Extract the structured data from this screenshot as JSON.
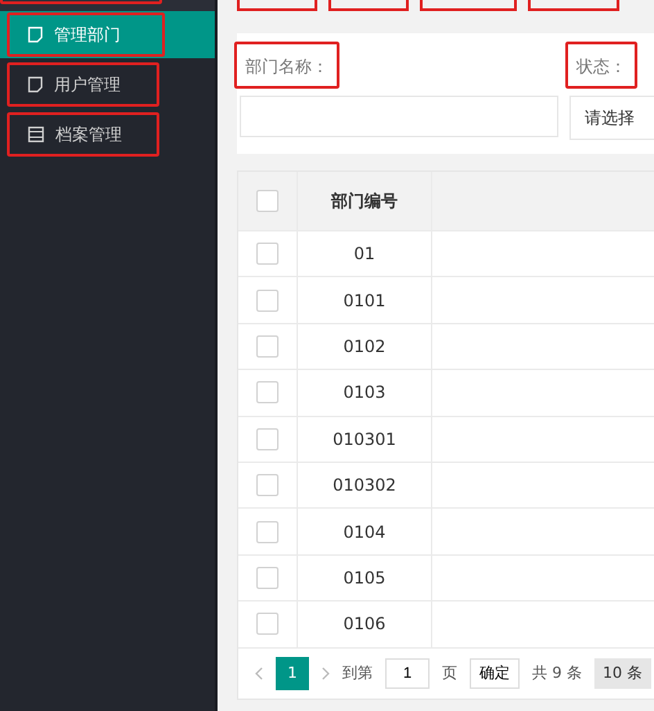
{
  "top_annotations": [
    {
      "kind": "box"
    },
    {
      "kind": "box"
    },
    {
      "kind": "box"
    },
    {
      "kind": "box"
    },
    {
      "kind": "box"
    }
  ],
  "sidebar": {
    "items": [
      {
        "label": "管理部门",
        "kind": "page",
        "selected": true,
        "highlighted": true
      },
      {
        "label": "用户管理",
        "kind": "page",
        "selected": false,
        "highlighted": true
      },
      {
        "label": "档案管理",
        "kind": "archive",
        "selected": false,
        "highlighted": true
      }
    ]
  },
  "search": {
    "fields": [
      {
        "label": "部门名称：",
        "kind": "text",
        "highlighted": true
      },
      {
        "label": "状态：",
        "kind": "select",
        "value": "请选择",
        "highlighted": true
      }
    ]
  },
  "table": {
    "select_all_checked": false,
    "columns": [
      "部门编号"
    ],
    "rows": [
      {
        "cells": [
          "01"
        ],
        "checked": false
      },
      {
        "cells": [
          "0101"
        ],
        "checked": false
      },
      {
        "cells": [
          "0102"
        ],
        "checked": false
      },
      {
        "cells": [
          "0103"
        ],
        "checked": false
      },
      {
        "cells": [
          "010301"
        ],
        "checked": false
      },
      {
        "cells": [
          "010302"
        ],
        "checked": false
      },
      {
        "cells": [
          "0104"
        ],
        "checked": false
      },
      {
        "cells": [
          "0105"
        ],
        "checked": false
      },
      {
        "cells": [
          "0106"
        ],
        "checked": false
      }
    ]
  },
  "pagination": {
    "pages": [
      {
        "label": "1",
        "selected": true
      }
    ],
    "goto_label": "到第",
    "goto_value": "1",
    "page_unit": "页",
    "confirm": "确定",
    "total": "共 9 条",
    "page_size": "10 条"
  }
}
